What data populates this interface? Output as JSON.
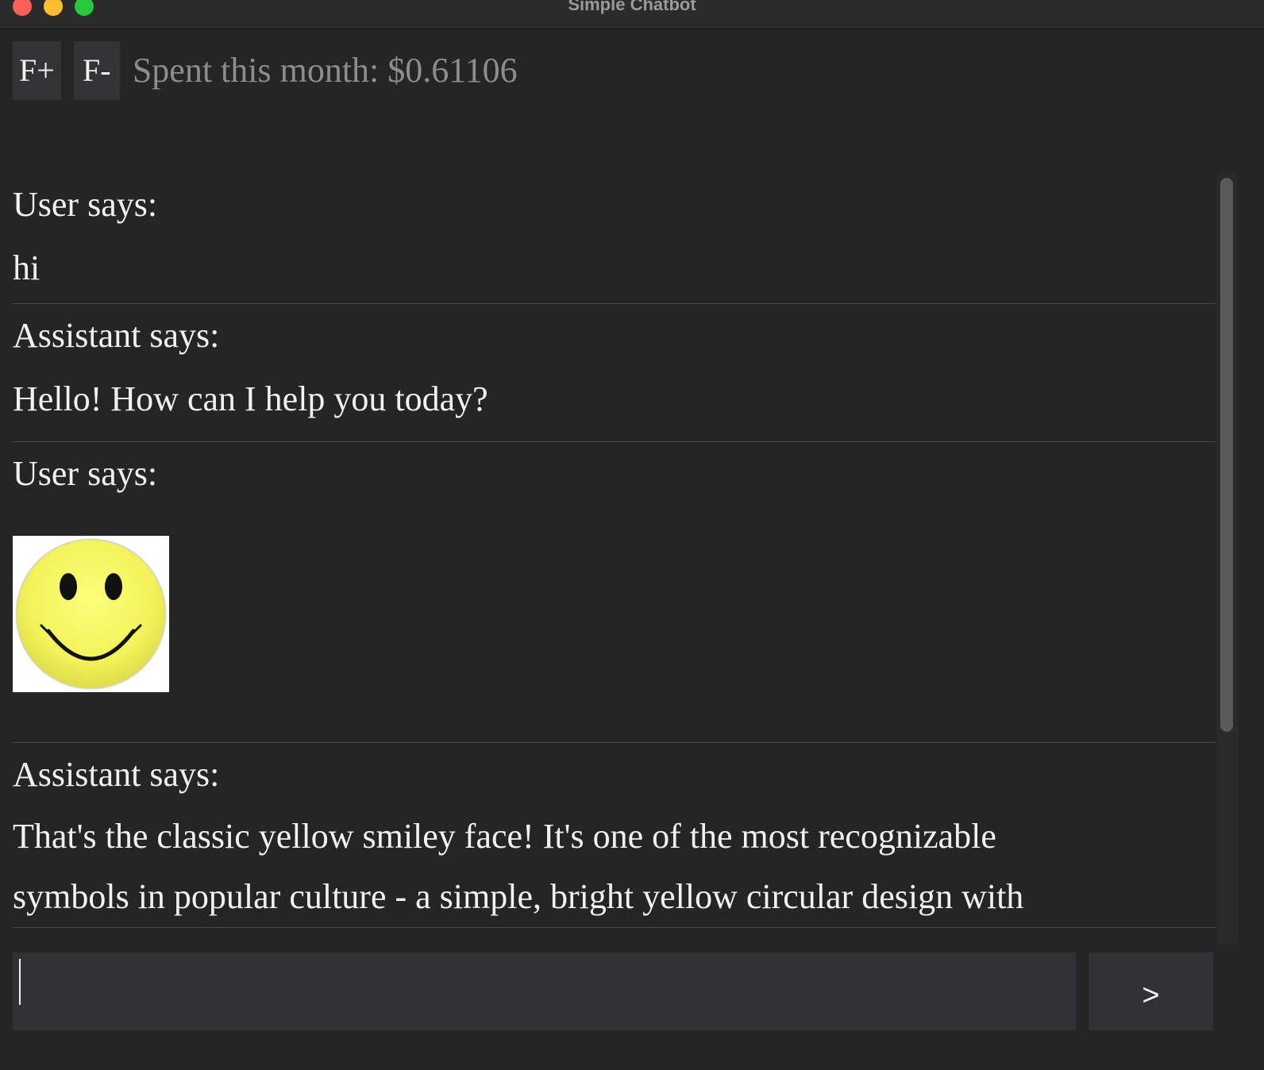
{
  "window": {
    "title": "Simple Chatbot"
  },
  "toolbar": {
    "font_increase_label": "F+",
    "font_decrease_label": "F-",
    "spent_text": "Spent this month: $0.61106"
  },
  "messages": [
    {
      "speaker": "User says:",
      "text": "hi"
    },
    {
      "speaker": "Assistant says:",
      "text": "Hello! How can I help you today?"
    },
    {
      "speaker": "User says:",
      "image": "smiley-face-image"
    },
    {
      "speaker": "Assistant says:",
      "lines": [
        "That's the classic yellow smiley face! It's one of the most recognizable",
        "symbols in popular culture - a simple, bright yellow circular design with"
      ]
    }
  ],
  "composer": {
    "value": "",
    "send_label": ">"
  },
  "colors": {
    "background": "#252525",
    "button_background": "#333336",
    "input_background": "#313136",
    "text": "#f1f1f1",
    "muted_text": "#8d8d8d",
    "smiley_yellow": "#f4f25a"
  }
}
